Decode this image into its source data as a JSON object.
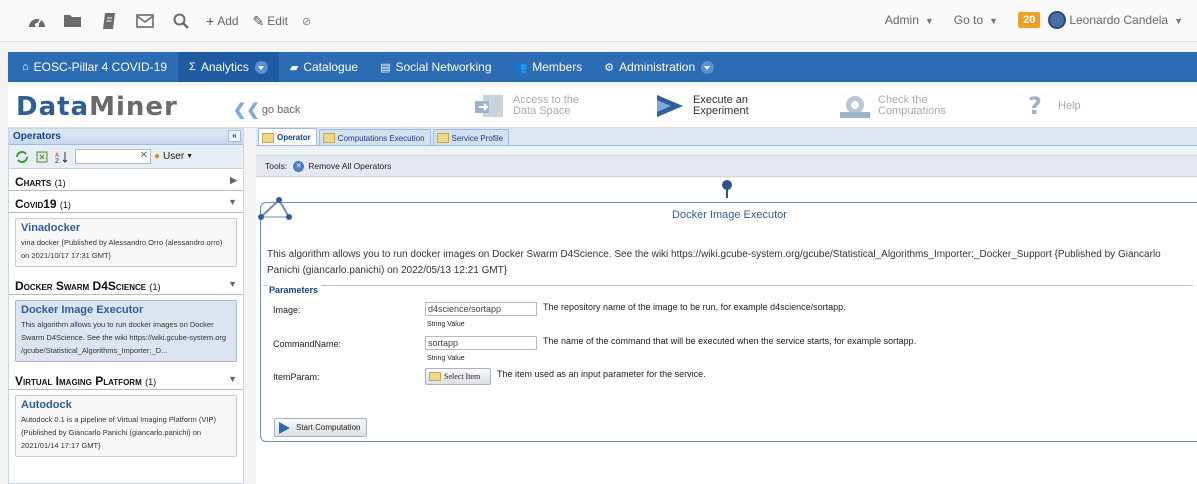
{
  "topbar": {
    "icons": [
      "dashboard-icon",
      "folder-icon",
      "notebook-icon",
      "mail-icon",
      "search-icon"
    ],
    "add_label": "Add",
    "edit_label": "Edit",
    "admin_label": "Admin",
    "goto_label": "Go to",
    "notifications": "20",
    "user_name": "Leonardo Candela"
  },
  "nav": {
    "items": [
      {
        "label": "EOSC-Pillar 4 COVID-19",
        "icon": "home-icon"
      },
      {
        "label": "Analytics",
        "icon": "sigma-icon",
        "active": true
      },
      {
        "label": "Catalogue",
        "icon": "book-icon"
      },
      {
        "label": "Social Networking",
        "icon": "chat-icon"
      },
      {
        "label": "Members",
        "icon": "people-icon"
      },
      {
        "label": "Administration",
        "icon": "gear-icon"
      }
    ]
  },
  "header": {
    "logo_part1": "Data",
    "logo_part2": "Miner",
    "go_back": "go back",
    "access_line1": "Access to the",
    "access_line2": "Data Space",
    "execute_line1": "Execute an",
    "execute_line2": "Experiment",
    "check_line1": "Check the",
    "check_line2": "Computations",
    "help": "Help"
  },
  "left": {
    "title": "Operators",
    "search_value": "",
    "user_label": "User",
    "categories": [
      {
        "name": "Charts",
        "count": "(1)"
      },
      {
        "name": "Covid19",
        "count": "(1)"
      },
      {
        "name": "Docker Swarm D4Science",
        "count": "(1)"
      },
      {
        "name": "Virtual Imaging Platform",
        "count": "(1)"
      }
    ],
    "ops": [
      {
        "name": "Vinadocker",
        "desc": "vina docker {Published by Alessandro Orro (alessandro.orro) on 2021/10/17 17:31 GMT}"
      },
      {
        "name": "Docker Image Executor",
        "desc": "This algorithm allows you to run docker images on Docker Swarm D4Science. See the wiki https://wiki.gcube-system.org /gcube/Statistical_Algorithms_Importer:_D..."
      },
      {
        "name": "Autodock",
        "desc": "Autodock 0.1 is a pipeline of Virtual Imaging Platform (VIP) {Published by Giancarlo Panichi (giancarlo.panichi) on 2021/01/14 17:17 GMT}"
      }
    ]
  },
  "tabs": [
    {
      "label": "Operator",
      "active": true
    },
    {
      "label": "Computations Execution"
    },
    {
      "label": "Service Profile"
    }
  ],
  "tools": {
    "label": "Tools:",
    "remove_all": "Remove All Operators"
  },
  "operator": {
    "title": "Docker Image Executor",
    "description": "This algorithm allows you to run docker images on Docker Swarm D4Science. See the wiki https://wiki.gcube-system.org/gcube/Statistical_Algorithms_Importer:_Docker_Support {Published by Giancarlo Panichi (giancarlo.panichi) on 2022/05/13 12:21 GMT}",
    "parameters_legend": "Parameters",
    "image_label": "Image:",
    "image_value": "d4science/sortapp",
    "image_desc": "The repository name of the image to be run, for example d4science/sortapp.",
    "string_value": "String Value",
    "command_label": "CommandName:",
    "command_value": "sortapp",
    "command_desc": "The name of the command that will be executed when the service starts, for example sortapp.",
    "item_label": "ItemParam:",
    "select_item": "Select Item",
    "item_desc": "The item used as an input parameter for the service.",
    "start": "Start Computation"
  }
}
